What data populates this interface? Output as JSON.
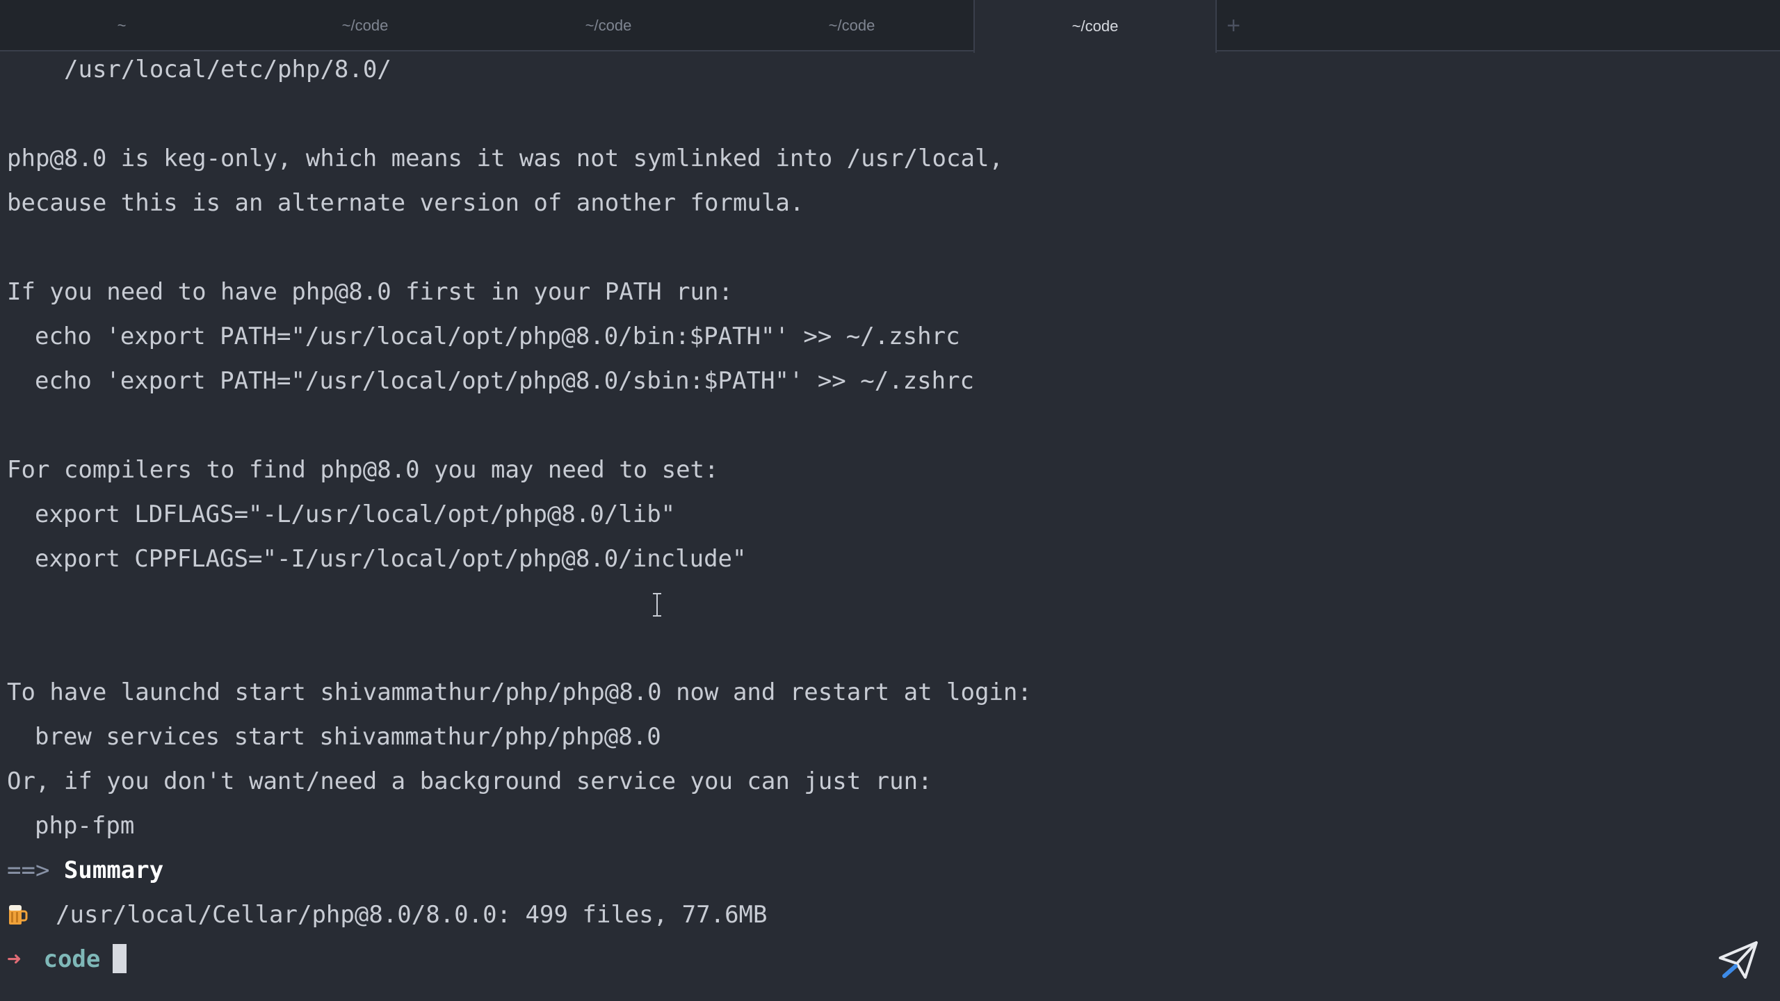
{
  "tabs": [
    {
      "label": "~",
      "active": false
    },
    {
      "label": "~/code",
      "active": false
    },
    {
      "label": "~/code",
      "active": false
    },
    {
      "label": "~/code",
      "active": false
    },
    {
      "label": "~/code",
      "active": true
    }
  ],
  "new_tab_label": "+",
  "lines": {
    "l1": "/usr/local/etc/php/8.0/",
    "l2": "php@8.0 is keg-only, which means it was not symlinked into /usr/local,",
    "l3": "because this is an alternate version of another formula.",
    "l4": "If you need to have php@8.0 first in your PATH run:",
    "l5": "echo 'export PATH=\"/usr/local/opt/php@8.0/bin:$PATH\"' >> ~/.zshrc",
    "l6": "echo 'export PATH=\"/usr/local/opt/php@8.0/sbin:$PATH\"' >> ~/.zshrc",
    "l7": "For compilers to find php@8.0 you may need to set:",
    "l8": "export LDFLAGS=\"-L/usr/local/opt/php@8.0/lib\"",
    "l9": "export CPPFLAGS=\"-I/usr/local/opt/php@8.0/include\"",
    "l10": "To have launchd start shivammathur/php/php@8.0 now and restart at login:",
    "l11": "brew services start shivammathur/php/php@8.0",
    "l12": "Or, if you don't want/need a background service you can just run:",
    "l13": "php-fpm",
    "summary_prefix": "==>",
    "summary_label": "Summary",
    "cellar": "/usr/local/Cellar/php@8.0/8.0.0: 499 files, 77.6MB"
  },
  "prompt": {
    "arrow": "➜",
    "dir": "code"
  },
  "colors": {
    "background": "#282c34",
    "tabbar": "#21252b",
    "prompt_arrow": "#e06c75",
    "prompt_dir": "#7fb8b8"
  }
}
